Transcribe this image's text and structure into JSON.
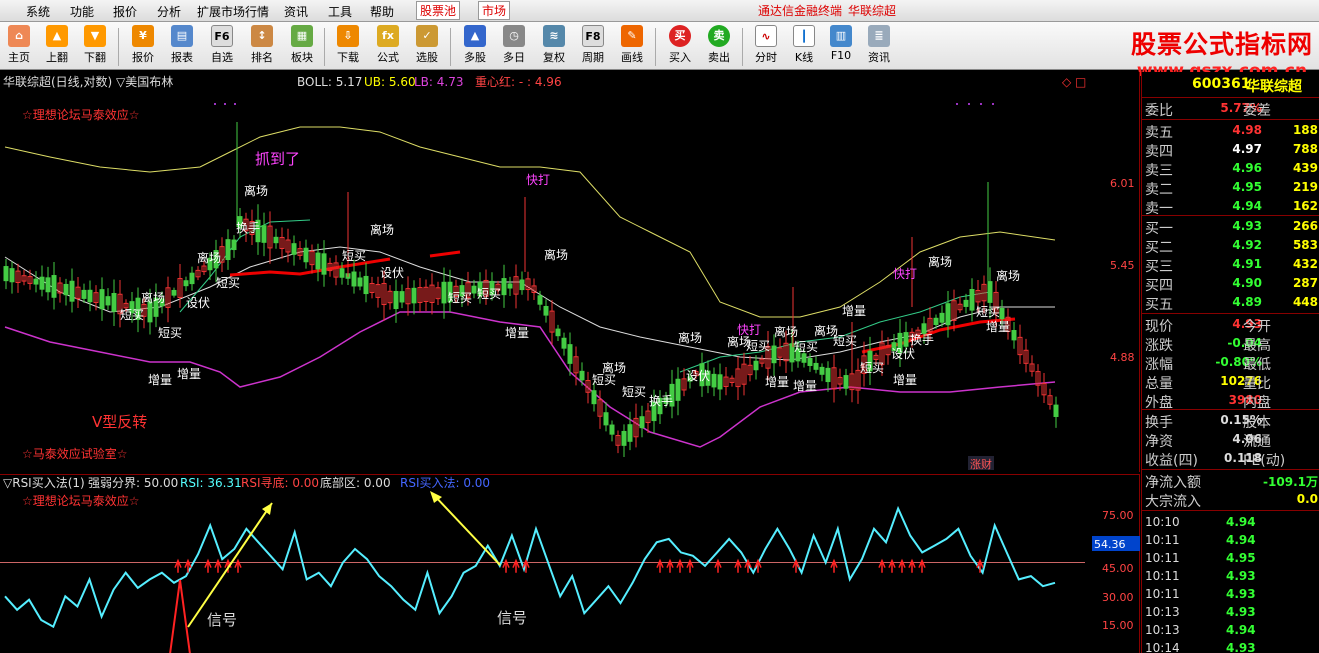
{
  "menu": {
    "items": [
      "系统",
      "功能",
      "报价",
      "分析",
      "扩展市场行情",
      "资讯",
      "工具",
      "帮助"
    ],
    "tab_stockpool": "股票池",
    "tab_market": "市场",
    "terminal_title": "通达信金融终端",
    "stock_title": "华联综超"
  },
  "toolbar": {
    "buttons": [
      "主页",
      "上翻",
      "下翻",
      "报价",
      "报表",
      "自选",
      "排名",
      "板块",
      "下载",
      "公式",
      "选股",
      "多股",
      "多日",
      "复权",
      "周期",
      "画线",
      "买入",
      "卖出",
      "分时",
      "K线",
      "F10",
      "资讯"
    ],
    "icon_text": {
      "f6": "F6",
      "f8": "F8",
      "buy": "买",
      "sell": "卖"
    }
  },
  "brand": {
    "line1": "股票公式指标网",
    "line2": "www.gszx.com.cn"
  },
  "main_chart": {
    "header_title": "华联综超(日线,对数) ▽美国布林",
    "boll": "BOLL: 5.17",
    "ub": "UB: 5.60",
    "lb": "LB: 4.73",
    "center_label": "重心红: -  : 4.96",
    "watermark_top": "☆理想论坛马泰效应☆",
    "watermark_bottom": "☆马泰效应试验室☆",
    "axis_ticks": [
      "6.01",
      "5.45",
      "4.88"
    ],
    "annot_zhuadao": "抓到了",
    "annot_vreverse": "V型反转",
    "badge": "涨财",
    "labels": [
      "离场",
      "换手",
      "离场",
      "离场",
      "短买",
      "短买",
      "短买",
      "设伏",
      "短买",
      "短买",
      "离场",
      "快打",
      "短买",
      "离场",
      "增量",
      "离场",
      "短买",
      "换手",
      "短买",
      "短买",
      "设伏",
      "增量",
      "增量",
      "增量",
      "快打",
      "离场",
      "离场",
      "离场",
      "离场",
      "短买",
      "短买",
      "短买",
      "设伏",
      "增量",
      "增量",
      "快打",
      "离场",
      "换手",
      "离场",
      "短买",
      "增量",
      "设伏",
      "增量"
    ]
  },
  "sub_chart": {
    "header": "▽RSI买入法(1)",
    "strong_weak": "强弱分界: 50.00",
    "rsi": "RSI: 36.31",
    "rsi_seek": "RSI寻底: 0.00",
    "bottom_zone": "底部区: 0.00",
    "rsi_buy": "RSI买入法: 0.00",
    "watermark": "☆理想论坛马泰效应☆",
    "signal_label": "信号",
    "axis_ticks": [
      "75.00",
      "45.00",
      "30.00",
      "15.00"
    ],
    "current_value": "54.36",
    "chart_data": {
      "type": "line",
      "series": [
        {
          "name": "RSI",
          "values": [
            30,
            22,
            28,
            16,
            12,
            30,
            24,
            40,
            18,
            34,
            44,
            35,
            40,
            44,
            38,
            42,
            55,
            72,
            52,
            58,
            70,
            62,
            54,
            46,
            68,
            40,
            44,
            36,
            50,
            58,
            52,
            42,
            36,
            28,
            22,
            44,
            20,
            30,
            44,
            48,
            60,
            48,
            66,
            46,
            70,
            50,
            30,
            42,
            20,
            28,
            36,
            26,
            38,
            52,
            62,
            64,
            56,
            54,
            48,
            56,
            64,
            56,
            44,
            58,
            70,
            58,
            44,
            66,
            50,
            70,
            40,
            52,
            70,
            62,
            82,
            66,
            56,
            60,
            64,
            70,
            54,
            44,
            72,
            56,
            40,
            42,
            36,
            38
          ]
        }
      ],
      "ylim": [
        0,
        90
      ]
    }
  },
  "quote_panel": {
    "code": "600361",
    "name": "华联综超",
    "weibi_label": "委比",
    "weibi_val": "5.77%",
    "weicha_label": "委差",
    "asks": [
      {
        "label": "卖五",
        "price": "4.98",
        "vol": "188"
      },
      {
        "label": "卖四",
        "price": "4.97",
        "vol": "788"
      },
      {
        "label": "卖三",
        "price": "4.96",
        "vol": "439"
      },
      {
        "label": "卖二",
        "price": "4.95",
        "vol": "219"
      },
      {
        "label": "卖一",
        "price": "4.94",
        "vol": "162"
      }
    ],
    "bids": [
      {
        "label": "买一",
        "price": "4.93",
        "vol": "266"
      },
      {
        "label": "买二",
        "price": "4.92",
        "vol": "583"
      },
      {
        "label": "买三",
        "price": "4.91",
        "vol": "432"
      },
      {
        "label": "买四",
        "price": "4.90",
        "vol": "287"
      },
      {
        "label": "买五",
        "price": "4.89",
        "vol": "448"
      }
    ],
    "stats": [
      {
        "l1": "现价",
        "v": "4.93",
        "l2": "今开"
      },
      {
        "l1": "涨跌",
        "v": "-0.04",
        "l2": "最高"
      },
      {
        "l1": "涨幅",
        "v": "-0.80%",
        "l2": "最低"
      },
      {
        "l1": "总量",
        "v": "10276",
        "l2": "量比"
      },
      {
        "l1": "外盘",
        "v": "3980",
        "l2": "内盘"
      }
    ],
    "stats2": [
      {
        "l1": "换手",
        "v": "0.15%",
        "l2": "股本"
      },
      {
        "l1": "净资",
        "v": "4.06",
        "l2": "流通"
      },
      {
        "l1": "收益(四)",
        "v": "0.118",
        "l2": "PE(动)"
      }
    ],
    "net_inflow_label": "净流入额",
    "net_inflow_val": "-109.1万",
    "big_inflow_label": "大宗流入",
    "big_inflow_val": "0.0",
    "ticks": [
      {
        "t": "10:10",
        "p": "4.94"
      },
      {
        "t": "10:11",
        "p": "4.94"
      },
      {
        "t": "10:11",
        "p": "4.95"
      },
      {
        "t": "10:11",
        "p": "4.93"
      },
      {
        "t": "10:11",
        "p": "4.93"
      },
      {
        "t": "10:13",
        "p": "4.93"
      },
      {
        "t": "10:13",
        "p": "4.94"
      },
      {
        "t": "10:14",
        "p": "4.93"
      }
    ]
  }
}
